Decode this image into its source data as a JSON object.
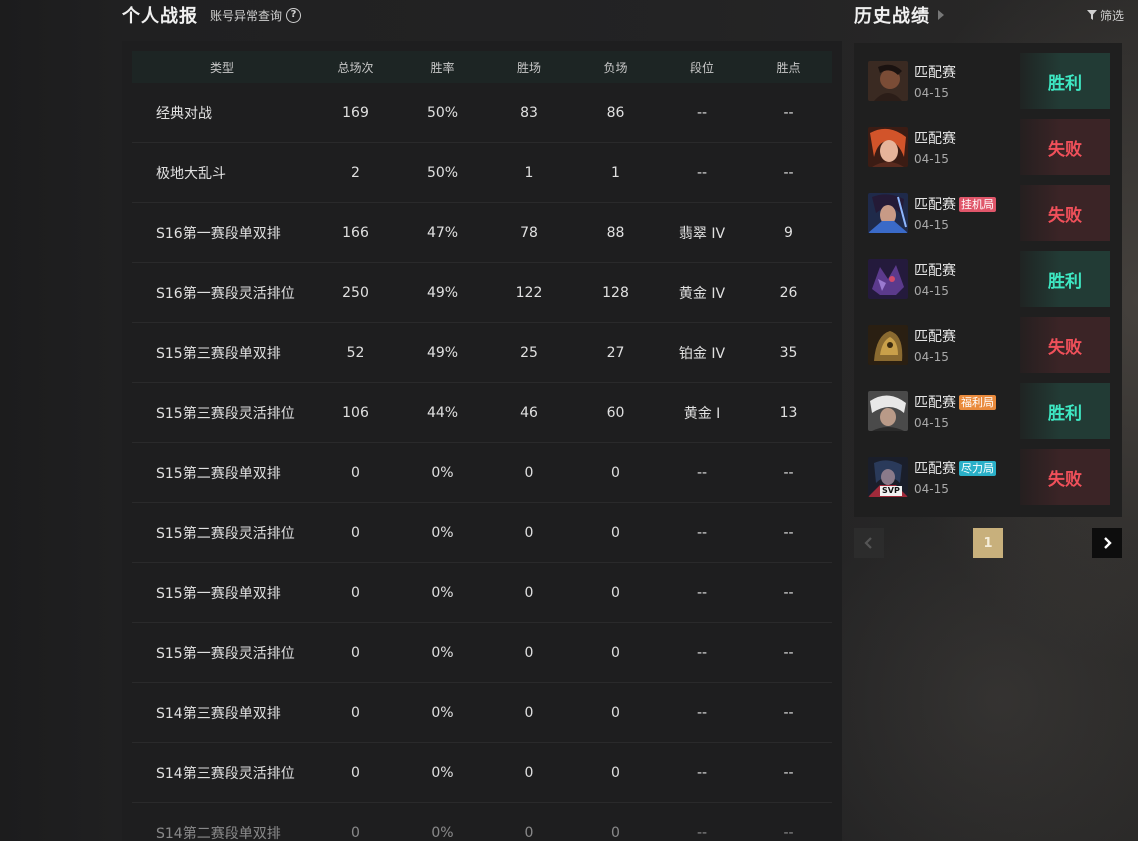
{
  "left": {
    "title": "个人战报",
    "abnormal_link": "账号异常查询",
    "help_icon": "?"
  },
  "table": {
    "headers": [
      "类型",
      "总场次",
      "胜率",
      "胜场",
      "负场",
      "段位",
      "胜点"
    ],
    "rows": [
      [
        "经典对战",
        "169",
        "50%",
        "83",
        "86",
        "--",
        "--"
      ],
      [
        "极地大乱斗",
        "2",
        "50%",
        "1",
        "1",
        "--",
        "--"
      ],
      [
        "S16第一赛段单双排",
        "166",
        "47%",
        "78",
        "88",
        "翡翠 IV",
        "9"
      ],
      [
        "S16第一赛段灵活排位",
        "250",
        "49%",
        "122",
        "128",
        "黄金 IV",
        "26"
      ],
      [
        "S15第三赛段单双排",
        "52",
        "49%",
        "25",
        "27",
        "铂金 IV",
        "35"
      ],
      [
        "S15第三赛段灵活排位",
        "106",
        "44%",
        "46",
        "60",
        "黄金 Ⅰ",
        "13"
      ],
      [
        "S15第二赛段单双排",
        "0",
        "0%",
        "0",
        "0",
        "--",
        "--"
      ],
      [
        "S15第二赛段灵活排位",
        "0",
        "0%",
        "0",
        "0",
        "--",
        "--"
      ],
      [
        "S15第一赛段单双排",
        "0",
        "0%",
        "0",
        "0",
        "--",
        "--"
      ],
      [
        "S15第一赛段灵活排位",
        "0",
        "0%",
        "0",
        "0",
        "--",
        "--"
      ],
      [
        "S14第三赛段单双排",
        "0",
        "0%",
        "0",
        "0",
        "--",
        "--"
      ],
      [
        "S14第三赛段灵活排位",
        "0",
        "0%",
        "0",
        "0",
        "--",
        "--"
      ],
      [
        "S14第二赛段单双排",
        "0",
        "0%",
        "0",
        "0",
        "--",
        "--"
      ]
    ]
  },
  "right": {
    "title": "历史战绩",
    "filter_label": "筛选"
  },
  "matches": [
    {
      "mode": "匹配赛",
      "tag": "",
      "date": "04-15",
      "result": "胜利",
      "outcome": "win",
      "portrait": "warrior-portrait-dark"
    },
    {
      "mode": "匹配赛",
      "tag": "",
      "date": "04-15",
      "result": "失败",
      "outcome": "loss",
      "portrait": "red-hair-portrait"
    },
    {
      "mode": "匹配赛",
      "tag": "挂机局",
      "tag_color": "#e0566a",
      "date": "04-15",
      "result": "失败",
      "outcome": "loss",
      "portrait": "swordsman-portrait"
    },
    {
      "mode": "匹配赛",
      "tag": "",
      "date": "04-15",
      "result": "胜利",
      "outcome": "win",
      "portrait": "purple-beast-portrait"
    },
    {
      "mode": "匹配赛",
      "tag": "",
      "date": "04-15",
      "result": "失败",
      "outcome": "loss",
      "portrait": "golden-armor-portrait"
    },
    {
      "mode": "匹配赛",
      "tag": "福利局",
      "tag_color": "#e98a3c",
      "date": "04-15",
      "result": "胜利",
      "outcome": "win",
      "portrait": "white-hair-portrait"
    },
    {
      "mode": "匹配赛",
      "tag": "尽力局",
      "tag_color": "#2ab0c8",
      "date": "04-15",
      "result": "失败",
      "outcome": "loss",
      "portrait": "svp-portrait",
      "badge": "SVP"
    }
  ],
  "pagination": {
    "current": "1"
  },
  "colors": {
    "win_text": "#3ee8c3",
    "loss_text": "#f0505a",
    "page_active": "#c8b07c"
  }
}
